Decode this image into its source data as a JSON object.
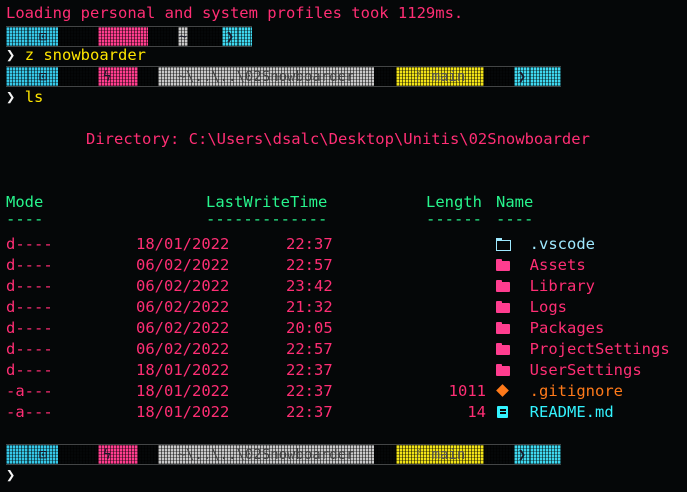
{
  "terminal": {
    "load_message": "Loading personal and system profiles took 1129ms.",
    "prompt_glyph": "❯",
    "command1": "z snowboarder",
    "command2": "ls",
    "directory_label": "Directory: C:\\Users\\dsalc\\Desktop\\Unitis\\02Snowboarder",
    "prompt_bar_short": {
      "terminal_icon": "⊡",
      "bolt": "",
      "path": "~",
      "arrow": "❯"
    },
    "prompt_bar": {
      "terminal_icon": "⊡",
      "bolt": "ϟ",
      "path": "~\\..\\..\\02Snowboarder",
      "branch_icon": "ᚠ",
      "branch": "main",
      "arrow": "❯"
    },
    "headers": {
      "mode": "Mode",
      "mode_ul": "----",
      "lastwrite": "LastWriteTime",
      "lastwrite_ul": "-------------",
      "length": "Length",
      "length_ul": "------",
      "name": "Name",
      "name_ul": "----"
    },
    "entries": [
      {
        "mode": "d----",
        "date": "18/01/2022",
        "time": "22:37",
        "length": "",
        "icon": "folder-code-icon",
        "name": ".vscode",
        "color": "#9fe9ff"
      },
      {
        "mode": "d----",
        "date": "06/02/2022",
        "time": "22:57",
        "length": "",
        "icon": "folder-icon",
        "name": "Assets",
        "color": "#ff2e74"
      },
      {
        "mode": "d----",
        "date": "06/02/2022",
        "time": "23:42",
        "length": "",
        "icon": "folder-icon",
        "name": "Library",
        "color": "#ff2e74"
      },
      {
        "mode": "d----",
        "date": "06/02/2022",
        "time": "21:32",
        "length": "",
        "icon": "folder-icon",
        "name": "Logs",
        "color": "#ff2e74"
      },
      {
        "mode": "d----",
        "date": "06/02/2022",
        "time": "20:05",
        "length": "",
        "icon": "folder-icon",
        "name": "Packages",
        "color": "#ff2e74"
      },
      {
        "mode": "d----",
        "date": "06/02/2022",
        "time": "22:57",
        "length": "",
        "icon": "folder-icon",
        "name": "ProjectSettings",
        "color": "#ff2e74"
      },
      {
        "mode": "d----",
        "date": "18/01/2022",
        "time": "22:37",
        "length": "",
        "icon": "folder-icon",
        "name": "UserSettings",
        "color": "#ff2e74"
      },
      {
        "mode": "-a---",
        "date": "18/01/2022",
        "time": "22:37",
        "length": "1011",
        "icon": "diamond-icon",
        "name": ".gitignore",
        "color": "#ff7a1a"
      },
      {
        "mode": "-a---",
        "date": "18/01/2022",
        "time": "22:37",
        "length": "14",
        "icon": "book-icon",
        "name": "README.md",
        "color": "#33f3ff"
      }
    ]
  }
}
